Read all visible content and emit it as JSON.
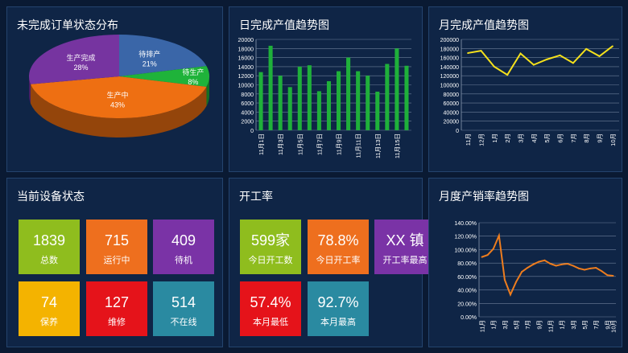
{
  "panels": {
    "status_dist": {
      "title": "未完成订单状态分布"
    },
    "daily": {
      "title": "日完成产值趋势图"
    },
    "monthly": {
      "title": "月完成产值趋势图"
    },
    "devices": {
      "title": "当前设备状态"
    },
    "utilization": {
      "title": "开工率"
    },
    "sales": {
      "title": "月度产销率趋势图"
    }
  },
  "device_tiles": [
    {
      "value": "1839",
      "label": "总数",
      "color": "#8fbd1e"
    },
    {
      "value": "715",
      "label": "运行中",
      "color": "#ee6f1e"
    },
    {
      "value": "409",
      "label": "待机",
      "color": "#7a33a6"
    },
    {
      "value": "74",
      "label": "保养",
      "color": "#f4b300"
    },
    {
      "value": "127",
      "label": "维修",
      "color": "#e5131a"
    },
    {
      "value": "514",
      "label": "不在线",
      "color": "#2a8aa1"
    }
  ],
  "util_tiles": [
    {
      "value": "599家",
      "label": "今日开工数",
      "color": "#8fbd1e"
    },
    {
      "value": "78.8%",
      "label": "今日开工率",
      "color": "#ee6f1e"
    },
    {
      "value": "XX 镇",
      "label": "开工率最高",
      "color": "#7a33a6"
    },
    {
      "value": "57.4%",
      "label": "本月最低",
      "color": "#e5131a"
    },
    {
      "value": "92.7%",
      "label": "本月最高",
      "color": "#2a8aa1"
    }
  ],
  "chart_data": [
    {
      "type": "pie",
      "title": "未完成订单状态分布",
      "slices": [
        {
          "label": "待排产",
          "value": 21,
          "display": "21%",
          "color": "#3a66a8"
        },
        {
          "label": "待生产",
          "value": 8,
          "display": "8%",
          "color": "#1fb33a"
        },
        {
          "label": "生产中",
          "value": 43,
          "display": "43%",
          "color": "#ee6f12"
        },
        {
          "label": "生产完成",
          "value": 28,
          "display": "28%",
          "color": "#7634a0"
        }
      ]
    },
    {
      "type": "bar",
      "title": "日完成产值趋势图",
      "categories": [
        "11月1日",
        "11月2日",
        "11月3日",
        "11月4日",
        "11月5日",
        "11月6日",
        "11月7日",
        "11月8日",
        "11月9日",
        "11月10日",
        "11月11日",
        "11月12日",
        "11月13日",
        "11月14日",
        "11月15日",
        "11月16日"
      ],
      "tick_labels": [
        "11月1日",
        "",
        "11月3日",
        "",
        "11月5日",
        "",
        "11月7日",
        "",
        "11月9日",
        "",
        "11月11日",
        "",
        "11月13日",
        "",
        "11月15日",
        ""
      ],
      "values": [
        12800,
        18600,
        12000,
        9500,
        14000,
        14300,
        8600,
        10800,
        13000,
        16000,
        13000,
        12000,
        8500,
        14600,
        18000,
        14200
      ],
      "ylim": [
        0,
        20000
      ],
      "yticks": [
        0,
        2000,
        4000,
        6000,
        8000,
        10000,
        12000,
        14000,
        16000,
        18000,
        20000
      ],
      "color": "#1fb03a",
      "grid": true
    },
    {
      "type": "line",
      "title": "月完成产值趋势图",
      "categories": [
        "11月",
        "12月",
        "1月",
        "2月",
        "3月",
        "4月",
        "5月",
        "6月",
        "7月",
        "8月",
        "9月",
        "10月"
      ],
      "values": [
        170000,
        175000,
        140000,
        122000,
        169000,
        144000,
        156000,
        165000,
        148000,
        179000,
        163000,
        185000
      ],
      "ylim": [
        0,
        200000
      ],
      "yticks": [
        0,
        20000,
        40000,
        60000,
        80000,
        100000,
        120000,
        140000,
        160000,
        180000,
        200000
      ],
      "color": "#f5e11c",
      "grid": true
    },
    {
      "type": "line",
      "title": "月度产销率趋势图",
      "categories": [
        "11月",
        "12月",
        "1月",
        "2月",
        "3月",
        "4月",
        "5月",
        "6月",
        "7月",
        "8月",
        "9月",
        "10月",
        "11月",
        "12月",
        "1月",
        "2月",
        "3月",
        "4月",
        "5月",
        "6月",
        "7月",
        "8月",
        "9月",
        "10月"
      ],
      "tick_labels": [
        "11月",
        "",
        "1月",
        "",
        "3月",
        "",
        "5月",
        "",
        "7月",
        "",
        "9月",
        "",
        "11月",
        "",
        "1月",
        "",
        "3月",
        "",
        "5月",
        "",
        "7月",
        "",
        "9月",
        "10月"
      ],
      "values": [
        89,
        92,
        101,
        121,
        55,
        33,
        52,
        67,
        73,
        78,
        82,
        84,
        79,
        76,
        78,
        79,
        76,
        72,
        70,
        72,
        73,
        68,
        62,
        61
      ],
      "ylim": [
        0,
        140
      ],
      "yticks": [
        0,
        20,
        40,
        60,
        80,
        100,
        120,
        140
      ],
      "ytick_labels": [
        "0.00%",
        "20.00%",
        "40.00%",
        "60.00%",
        "80.00%",
        "100.00%",
        "120.00%",
        "140.00%"
      ],
      "color": "#ee7d1e",
      "grid": true
    }
  ]
}
